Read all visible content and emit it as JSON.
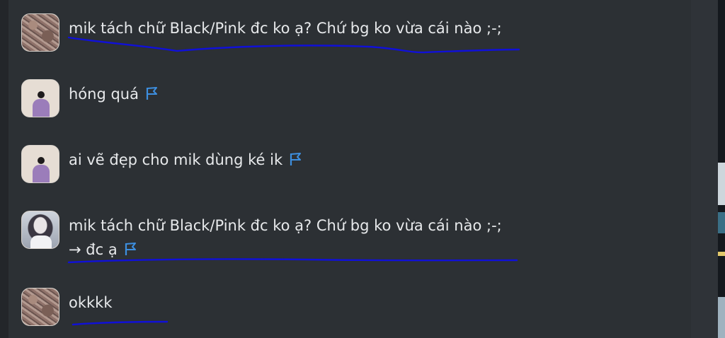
{
  "messages": [
    {
      "avatar": "fur-avatar",
      "lines": [
        "mik tách chữ Black/Pink đc ko ạ? Chứ bg ko vừa cái nào ;-;"
      ],
      "flagged": false
    },
    {
      "avatar": "girl-avatar",
      "lines": [
        "hóng quá"
      ],
      "flagged": true
    },
    {
      "avatar": "girl-avatar",
      "lines": [
        "ai vẽ đẹp cho mik dùng ké ik"
      ],
      "flagged": true
    },
    {
      "avatar": "photo-avatar",
      "lines": [
        "mik tách chữ Black/Pink đc ko ạ? Chứ bg ko vừa cái nào ;-;",
        "→ đc ạ"
      ],
      "flagged": true
    },
    {
      "avatar": "fur-avatar",
      "lines": [
        "okkkk"
      ],
      "flagged": false
    }
  ],
  "colors": {
    "panel": "#2c3034",
    "text": "#e7e9eb",
    "flag": "#3d8fe0",
    "pen": "#1010d8"
  },
  "icons": {
    "flag": "flag-icon"
  }
}
